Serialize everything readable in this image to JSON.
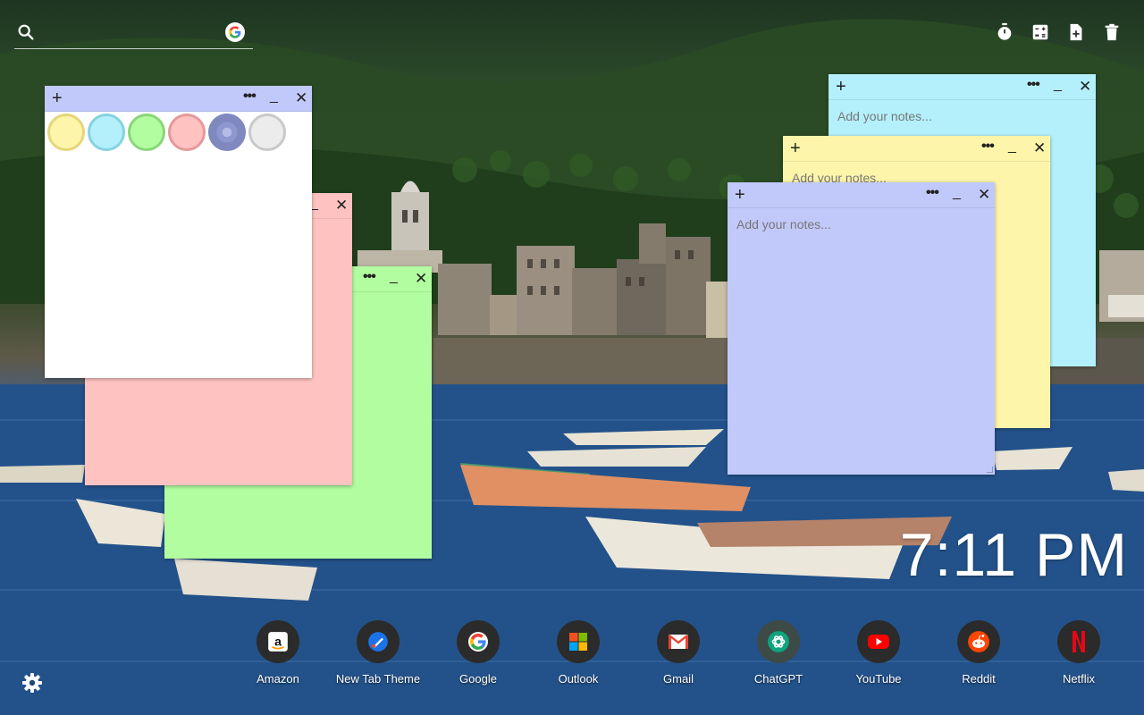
{
  "search": {
    "placeholder": "",
    "engine_icon": "google-g-icon"
  },
  "toolbar": {
    "items": [
      {
        "icon": "timer-icon"
      },
      {
        "icon": "calculator-icon"
      },
      {
        "icon": "add-note-icon"
      },
      {
        "icon": "trash-icon"
      }
    ]
  },
  "notes": [
    {
      "color": "#b3f0fb",
      "placeholder": "Add your notes...",
      "value": ""
    },
    {
      "color": "#fdf5a9",
      "placeholder": "Add your notes...",
      "value": ""
    },
    {
      "color": "#c1c9fa",
      "placeholder": "Add your notes...",
      "value": ""
    },
    {
      "color": "#fec2c1",
      "placeholder": "",
      "value": ""
    },
    {
      "color": "#b2fd9f",
      "placeholder": "",
      "value": ""
    },
    {
      "color": "#ffffff",
      "placeholder": "",
      "value": "",
      "header_color": "#c1c9fa"
    }
  ],
  "note_header": {
    "add": "+",
    "more": "•••",
    "minimize": "_",
    "close": "✕"
  },
  "color_picker": {
    "swatches": [
      {
        "fill": "#fdf5a9",
        "ring": "#e6d67a"
      },
      {
        "fill": "#b3f0fb",
        "ring": "#86d3e0"
      },
      {
        "fill": "#b2fd9f",
        "ring": "#8ad67b"
      },
      {
        "fill": "#fec2c1",
        "ring": "#e49a9a"
      },
      {
        "fill": "#9aa3d4",
        "ring": "#7f89bf",
        "selected": true
      },
      {
        "fill": "#ececec",
        "ring": "#c9c9c9"
      }
    ]
  },
  "clock": {
    "time": "7:11 PM"
  },
  "shortcuts": [
    {
      "label": "Amazon",
      "icon": "amazon-icon"
    },
    {
      "label": "New Tab Theme",
      "icon": "new-tab-theme-icon"
    },
    {
      "label": "Google",
      "icon": "google-icon"
    },
    {
      "label": "Outlook",
      "icon": "outlook-icon"
    },
    {
      "label": "Gmail",
      "icon": "gmail-icon"
    },
    {
      "label": "ChatGPT",
      "icon": "chatgpt-icon"
    },
    {
      "label": "YouTube",
      "icon": "youtube-icon"
    },
    {
      "label": "Reddit",
      "icon": "reddit-icon"
    },
    {
      "label": "Netflix",
      "icon": "netflix-icon"
    }
  ],
  "settings": {
    "icon": "gear-icon"
  }
}
